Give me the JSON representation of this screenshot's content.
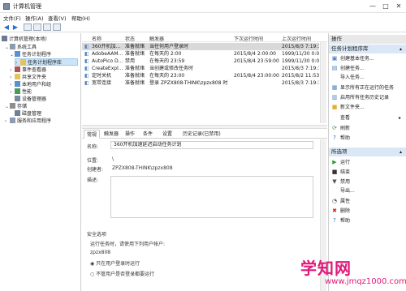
{
  "window": {
    "title": "计算机管理",
    "minimize": "—",
    "maximize": "□",
    "close": "✕"
  },
  "menu": {
    "items": [
      "文件(F)",
      "操作(A)",
      "查看(V)",
      "帮助(H)"
    ]
  },
  "tree": {
    "root": "计算机管理(本地)",
    "items": [
      {
        "label": "系统工具",
        "level": 1,
        "arrow": "⌄"
      },
      {
        "label": "任务计划程序",
        "level": 2,
        "arrow": "⌄"
      },
      {
        "label": "任务计划程序库",
        "level": 3,
        "arrow": "›"
      },
      {
        "label": "事件查看器",
        "level": 2,
        "arrow": "›"
      },
      {
        "label": "共享文件夹",
        "level": 2,
        "arrow": "›"
      },
      {
        "label": "本地用户和组",
        "level": 2,
        "arrow": "›"
      },
      {
        "label": "性能",
        "level": 2,
        "arrow": "›"
      },
      {
        "label": "设备管理器",
        "level": 2,
        "arrow": ""
      },
      {
        "label": "存储",
        "level": 1,
        "arrow": "⌄"
      },
      {
        "label": "磁盘管理",
        "level": 2,
        "arrow": ""
      },
      {
        "label": "服务和应用程序",
        "level": 1,
        "arrow": "›"
      }
    ]
  },
  "tasks": {
    "columns": [
      "名称",
      "状态",
      "触发器",
      "下次运行时间",
      "上次运行时间"
    ],
    "rows": [
      [
        "360开机加...",
        "准备就绪",
        "当任何用户登录时",
        "",
        "2015/8/3 7:19:18"
      ],
      [
        "AdobeAAM...",
        "准备就绪",
        "在每天的 2:00",
        "2015/8/4 2:00:00",
        "1999/11/30 0:00:0"
      ],
      [
        "AutoPico D...",
        "禁用",
        "在每天的 23:59",
        "2015/8/4 23:59:00",
        "1999/11/30 0:00:0"
      ],
      [
        "CreateExpl...",
        "准备就绪",
        "当创建或修改任务时",
        "",
        "2015/8/3 7:19:18"
      ],
      [
        "定时关机",
        "准备就绪",
        "在每天的 23:00",
        "2015/8/4 23:00:00",
        "2015/8/2 11:53:23"
      ],
      [
        "宽带连接",
        "准备就绪",
        "登录 ZPZX808-THINK\\zpzx808 时",
        "",
        "2015/8/3 7:19:18"
      ]
    ]
  },
  "tabs": [
    "常规",
    "触发器",
    "操作",
    "条件",
    "设置",
    "历史记录(已禁用)"
  ],
  "general": {
    "name_label": "名称:",
    "name_value": "360开机加速延迟启动任务计划",
    "location_label": "位置:",
    "location_value": "\\",
    "author_label": "创建者:",
    "author_value": "ZPZX808-THINK\\zpzx808",
    "desc_label": "描述:",
    "security_label": "安全选项",
    "run_as_label": "运行任务时，请使用下列用户帐户:",
    "run_as_value": "zpzx808",
    "only_logged_on": "只在用户登录时运行",
    "not_logged": "不管用户是否登录都要运行"
  },
  "actions": {
    "header1": "操作",
    "group1": "任务计划程序库",
    "group1_items": [
      {
        "label": "创建基本任务...",
        "icon": "▣"
      },
      {
        "label": "创建任务...",
        "icon": "▤"
      },
      {
        "label": "导入任务...",
        "icon": ""
      },
      {
        "label": "显示所有正在运行的任务",
        "icon": "▦"
      },
      {
        "label": "启用所有任务历史记录",
        "icon": "▥"
      },
      {
        "label": "新文件夹...",
        "icon": "■"
      },
      {
        "label": "查看",
        "icon": "",
        "submenu": true
      },
      {
        "label": "刷新",
        "icon": "⟳"
      },
      {
        "label": "帮助",
        "icon": "?"
      }
    ],
    "group2": "所选项",
    "group2_items": [
      {
        "label": "运行",
        "icon": "▶"
      },
      {
        "label": "结束",
        "icon": "■"
      },
      {
        "label": "禁用",
        "icon": "▼"
      },
      {
        "label": "导出...",
        "icon": ""
      },
      {
        "label": "属性",
        "icon": "◔"
      },
      {
        "label": "删除",
        "icon": "✖"
      },
      {
        "label": "帮助",
        "icon": "?"
      }
    ],
    "caret": "▴"
  },
  "watermark": {
    "main": "学知网",
    "url": "www.jmqz1000.com"
  },
  "colors": {
    "selection": "#cce4f7",
    "action_group": "#d9e7f6",
    "watermark": "#e0197a"
  }
}
